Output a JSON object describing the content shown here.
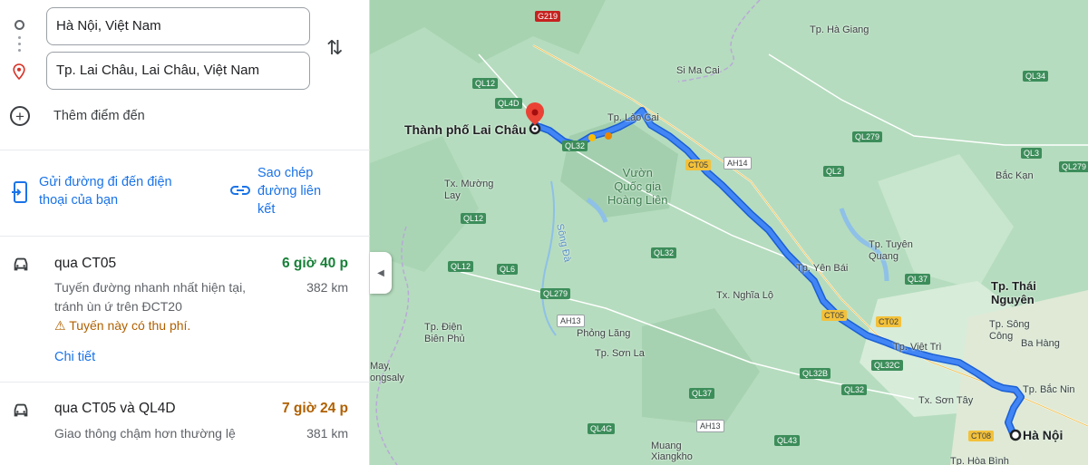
{
  "directions": {
    "origin": "Hà Nội, Việt Nam",
    "destination": "Tp. Lai Châu, Lai Châu, Việt Nam",
    "add_stop": "Thêm điểm đến"
  },
  "share": {
    "send_to_phone": [
      "Gửi đường đi đến điện",
      "thoại của bạn"
    ],
    "copy_link": [
      "Sao chép",
      "đường liên",
      "kết"
    ]
  },
  "routes": [
    {
      "via": "qua CT05",
      "time": "6 giờ 40 p",
      "time_color": "#188038",
      "desc": [
        "Tuyến đường nhanh nhất hiện tại,",
        "tránh ùn ứ trên ĐCT20"
      ],
      "distance": "382 km",
      "warning": "Tuyến này có thu phí.",
      "details": "Chi tiết"
    },
    {
      "via": "qua CT05 và QL4D",
      "time": "7 giờ 24 p",
      "time_color": "#b06000",
      "desc": [
        "Giao thông chậm hơn thường lệ"
      ],
      "distance": "381 km"
    }
  ],
  "map": {
    "places": {
      "lai_chau": "Thành phố Lai Châu",
      "ha_noi": "Hà Nội",
      "thai_nguyen": [
        "Tp. Thái",
        "Nguyên"
      ],
      "park": [
        "Vườn",
        "Quốc gia",
        "Hoàng Liên"
      ],
      "ha_giang": "Tp. Hà Giang",
      "si_ma_cai": "Si Ma Cai",
      "lao_cai": "Tp. Lào Cai",
      "bac_kan": "Bắc Kạn",
      "muong_lay": [
        "Tx. Mường",
        "Lay"
      ],
      "yen_bai": "Tp. Yên Bái",
      "tuyen_quang": [
        "Tp. Tuyên",
        "Quang"
      ],
      "nghia_lo": "Tx. Nghĩa Lộ",
      "dien_bien": [
        "Tp. Điện",
        "Biên Phủ"
      ],
      "phong_lang": "Phỏng Lăng",
      "son_la": "Tp. Sơn La",
      "viet_tri": "Tp. Việt Trì",
      "son_tay": "Tx. Sơn Tây",
      "song_cong": [
        "Tp. Sông",
        "Công"
      ],
      "ba_hang": "Ba Hàng",
      "muang": [
        "Muang",
        "Xiangkho"
      ],
      "may": [
        "May,",
        "ongsaly"
      ],
      "hoa_binh": "Tp. Hòa Bình",
      "bac_ninh": "Tp. Bắc Nin",
      "river": "Sông Đà"
    },
    "shields": {
      "g219": "G219",
      "ql12a": "QL12",
      "ql4d": "QL4D",
      "ql32a": "QL32",
      "ct05a": "CT05",
      "ah14": "AH14",
      "ql279a": "QL279",
      "ql2": "QL2",
      "ql34": "QL34",
      "ql3": "QL3",
      "ql279b": "QL279",
      "ql12b": "QL12",
      "ql6": "QL6",
      "ql12c": "QL12",
      "ql279c": "QL279",
      "ah13a": "AH13",
      "ql32b": "QL32",
      "ct05b": "CT05",
      "ct02": "CT02",
      "ql37": "QL37",
      "ql32b2": "QL32B",
      "ql32c": "QL32C",
      "ql32d": "QL32",
      "ql37b": "QL37",
      "ah13b": "AH13",
      "ql4g": "QL4G",
      "ql43": "QL43",
      "ct08": "CT08"
    }
  }
}
